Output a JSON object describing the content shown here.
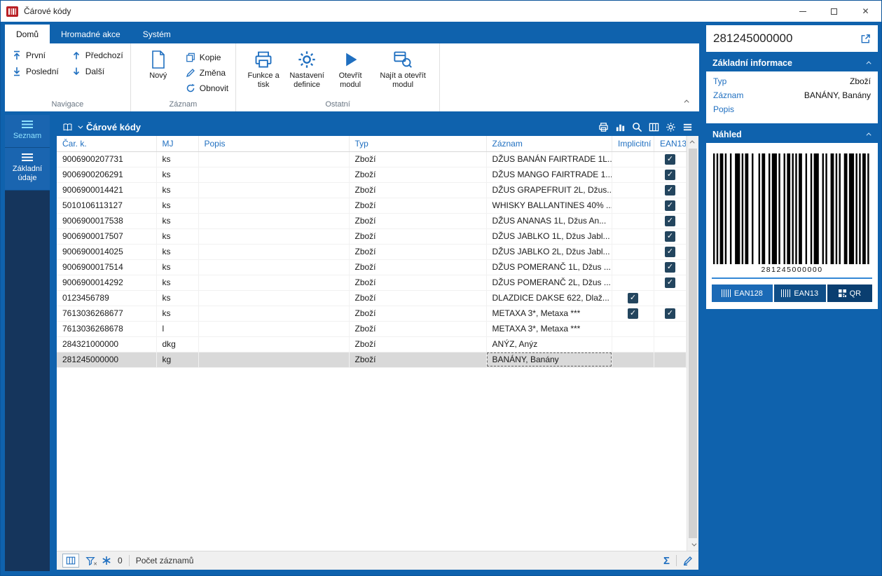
{
  "window": {
    "title": "Čárové kódy"
  },
  "ribbon": {
    "tabs": [
      {
        "label": "Domů"
      },
      {
        "label": "Hromadné akce"
      },
      {
        "label": "Systém"
      }
    ],
    "groups": [
      {
        "label": "Navigace",
        "items": [
          {
            "label": "První"
          },
          {
            "label": "Poslední"
          },
          {
            "label": "Předchozí"
          },
          {
            "label": "Další"
          }
        ]
      },
      {
        "label": "Záznam",
        "items": [
          {
            "label": "Nový"
          },
          {
            "label": "Kopie"
          },
          {
            "label": "Změna"
          },
          {
            "label": "Obnovit"
          }
        ]
      },
      {
        "label": "Ostatní",
        "items": [
          {
            "label": "Funkce a tisk"
          },
          {
            "label": "Nastavení definice"
          },
          {
            "label": "Otevřít modul"
          },
          {
            "label": "Najít a otevřít modul"
          }
        ]
      }
    ]
  },
  "sidebar": {
    "items": [
      {
        "label": "Seznam"
      },
      {
        "label": "Základní údaje"
      }
    ]
  },
  "grid": {
    "title": "Čárové kódy",
    "columns": [
      "Čar. k.",
      "MJ",
      "Popis",
      "Typ",
      "Záznam",
      "Implicitní",
      "EAN13"
    ],
    "rows": [
      {
        "code": "9006900207731",
        "mj": "ks",
        "popis": "",
        "typ": "Zboží",
        "zaznam": "DŽUS BANÁN FAIRTRADE 1L...",
        "implicitni": false,
        "ean13": true,
        "selected": false
      },
      {
        "code": "9006900206291",
        "mj": "ks",
        "popis": "",
        "typ": "Zboží",
        "zaznam": "DŽUS MANGO FAIRTRADE 1...",
        "implicitni": false,
        "ean13": true,
        "selected": false
      },
      {
        "code": "9006900014421",
        "mj": "ks",
        "popis": "",
        "typ": "Zboží",
        "zaznam": "DŽUS GRAPEFRUIT 2L, Džus...",
        "implicitni": false,
        "ean13": true,
        "selected": false
      },
      {
        "code": "5010106113127",
        "mj": "ks",
        "popis": "",
        "typ": "Zboží",
        "zaznam": "WHISKY BALLANTINES 40% ...",
        "implicitni": false,
        "ean13": true,
        "selected": false
      },
      {
        "code": "9006900017538",
        "mj": "ks",
        "popis": "",
        "typ": "Zboží",
        "zaznam": "DŽUS ANANAS 1L, Džus An...",
        "implicitni": false,
        "ean13": true,
        "selected": false
      },
      {
        "code": "9006900017507",
        "mj": "ks",
        "popis": "",
        "typ": "Zboží",
        "zaznam": "DŽUS JABLKO 1L, Džus Jabl...",
        "implicitni": false,
        "ean13": true,
        "selected": false
      },
      {
        "code": "9006900014025",
        "mj": "ks",
        "popis": "",
        "typ": "Zboží",
        "zaznam": "DŽUS JABLKO 2L, Džus Jabl...",
        "implicitni": false,
        "ean13": true,
        "selected": false
      },
      {
        "code": "9006900017514",
        "mj": "ks",
        "popis": "",
        "typ": "Zboží",
        "zaznam": "DŽUS POMERANČ 1L, Džus ...",
        "implicitni": false,
        "ean13": true,
        "selected": false
      },
      {
        "code": "9006900014292",
        "mj": "ks",
        "popis": "",
        "typ": "Zboží",
        "zaznam": "DŽUS POMERANČ 2L, Džus ...",
        "implicitni": false,
        "ean13": true,
        "selected": false
      },
      {
        "code": "0123456789",
        "mj": "ks",
        "popis": "",
        "typ": "Zboží",
        "zaznam": "DLAZDICE DAKSE 622, Dlaž...",
        "implicitni": true,
        "ean13": false,
        "selected": false
      },
      {
        "code": "7613036268677",
        "mj": "ks",
        "popis": "",
        "typ": "Zboží",
        "zaznam": "METAXA 3*, Metaxa ***",
        "implicitni": true,
        "ean13": true,
        "selected": false
      },
      {
        "code": "7613036268678",
        "mj": "l",
        "popis": "",
        "typ": "Zboží",
        "zaznam": "METAXA 3*, Metaxa ***",
        "implicitni": false,
        "ean13": false,
        "selected": false
      },
      {
        "code": "284321000000",
        "mj": "dkg",
        "popis": "",
        "typ": "Zboží",
        "zaznam": "ANÝZ, Anýz",
        "implicitni": false,
        "ean13": false,
        "selected": false
      },
      {
        "code": "281245000000",
        "mj": "kg",
        "popis": "",
        "typ": "Zboží",
        "zaznam": "BANÁNY, Banány",
        "implicitni": false,
        "ean13": false,
        "selected": true
      }
    ],
    "statusbar": {
      "filter_count": "0",
      "records_label": "Počet záznamů"
    }
  },
  "detail": {
    "record_id": "281245000000",
    "info": {
      "header": "Základní informace",
      "fields": [
        {
          "label": "Typ",
          "value": "Zboží"
        },
        {
          "label": "Záznam",
          "value": "BANÁNY, Banány"
        },
        {
          "label": "Popis",
          "value": ""
        }
      ]
    },
    "preview": {
      "header": "Náhled",
      "barcode_value": "281245000000",
      "formats": [
        {
          "label": "EAN128"
        },
        {
          "label": "EAN13"
        },
        {
          "label": "QR"
        }
      ]
    }
  }
}
